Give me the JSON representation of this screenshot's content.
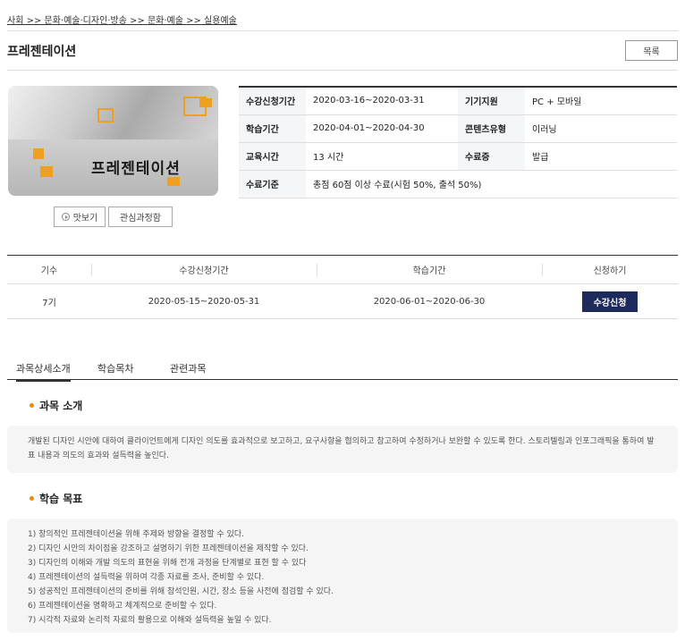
{
  "breadcrumb": "사회 >> 문화·예술·디자인·방송 >> 문화·예술 >> 실용예술",
  "page_title": "프레젠테이션",
  "list_button": "목록",
  "thumbnail_label": "프레젠테이션",
  "preview_button": "맛보기",
  "interest_button": "관심과정함",
  "info": {
    "enroll_period_label": "수강신청기간",
    "enroll_period_value": "2020-03-16~2020-03-31",
    "device_label": "기기지원",
    "device_value": "PC + 모바일",
    "study_period_label": "학습기간",
    "study_period_value": "2020-04-01~2020-04-30",
    "content_type_label": "콘텐츠유형",
    "content_type_value": "이러닝",
    "edu_time_label": "교육시간",
    "edu_time_value": "13 시간",
    "certificate_label": "수료증",
    "certificate_value": "발급",
    "criteria_label": "수료기준",
    "criteria_value": "총점 60점 이상 수료(시험 50%, 출석 50%)"
  },
  "schedule": {
    "headers": [
      "기수",
      "수강신청기간",
      "학습기간",
      "신청하기"
    ],
    "row": {
      "term": "7기",
      "enroll_period": "2020-05-15~2020-05-31",
      "study_period": "2020-06-01~2020-06-30",
      "apply_label": "수강신청"
    }
  },
  "tabs": [
    "과목상세소개",
    "학습목차",
    "관련과목"
  ],
  "intro": {
    "title": "과목 소개",
    "text": "개발된 디자인 시안에 대하여 클라이언트에게 디자인 의도를 효과적으로 보고하고, 요구사항을 협의하고 참고하여 수정하거나 보완할 수 있도록 한다. 스토리텔링과 인포그래픽을 통하여 발표 내용과 의도의 효과와 설득력을 높인다."
  },
  "goals": {
    "title": "학습 목표",
    "items": [
      "1) 창의적인 프레젠테이션을 위해 주제와 방향을 결정할 수 있다.",
      "2) 디자인 시안의 차이점을 강조하고 설명하기 위한 프레젠테이션을 제작할 수 있다.",
      "3) 디자인의 이해와 개발 의도의 표현을 위해 전개 과정을 단계별로 표현 할 수 있다",
      "4) 프레젠테이션의 설득력을 위하여 각종 자료를 조사, 준비할 수 있다.",
      "5) 성공적인 프레젠테이션의 준비를 위해 참석인원, 시간, 장소 등을 사전에 점검할 수 있다.",
      "6) 프레젠테이션을 명확하고 체계적으로 준비할 수 있다.",
      "7) 시각적 자료와 논리적 자료의 활용으로 이해와 설득력을 높일 수 있다."
    ]
  },
  "colors": {
    "accent_dot": "#f08a00",
    "apply_button_bg": "#1f2a5c",
    "thumbnail_accent": "#f0a020"
  }
}
